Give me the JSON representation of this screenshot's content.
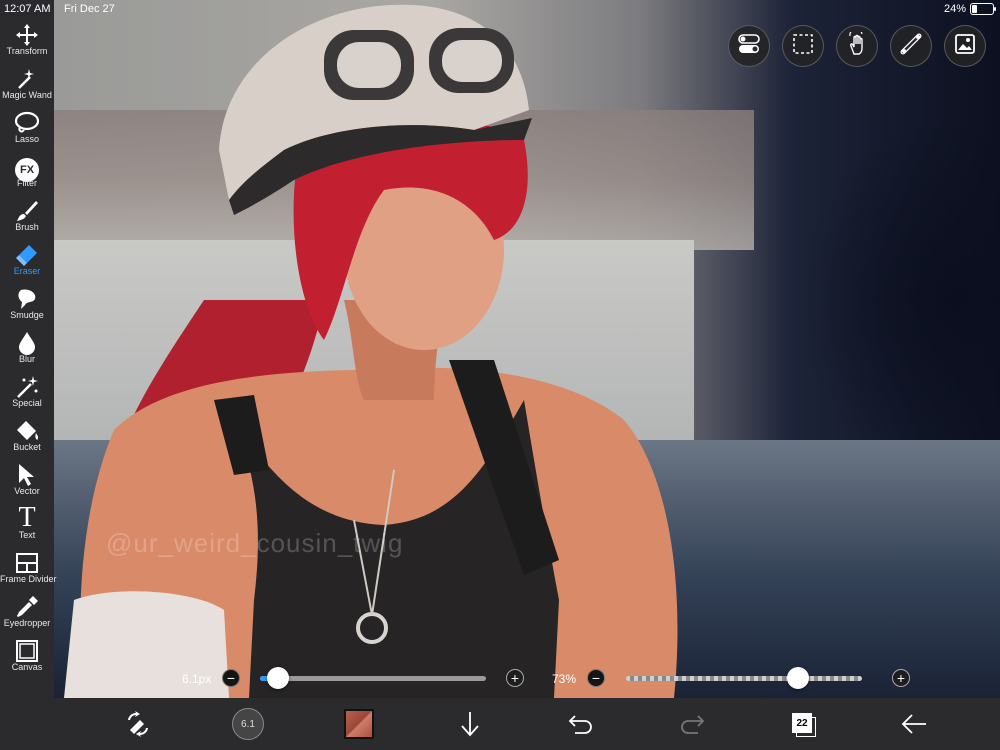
{
  "status_bar": {
    "time": "12:07 AM",
    "date": "Fri Dec 27",
    "battery_percent": "24%",
    "battery_level": 0.24
  },
  "toolbar": {
    "tools": [
      {
        "label": "Transform",
        "icon": "move-arrows-icon"
      },
      {
        "label": "Magic Wand",
        "icon": "magic-wand-icon"
      },
      {
        "label": "Lasso",
        "icon": "lasso-icon"
      },
      {
        "label": "Filter",
        "icon": "fx-icon",
        "glyph": "FX"
      },
      {
        "label": "Brush",
        "icon": "brush-icon"
      },
      {
        "label": "Eraser",
        "icon": "eraser-icon",
        "active": true
      },
      {
        "label": "Smudge",
        "icon": "smudge-icon"
      },
      {
        "label": "Blur",
        "icon": "droplet-icon"
      },
      {
        "label": "Special",
        "icon": "special-sparkle-icon"
      },
      {
        "label": "Bucket",
        "icon": "bucket-icon"
      },
      {
        "label": "Vector",
        "icon": "cursor-arrow-icon"
      },
      {
        "label": "Text",
        "icon": "text-icon",
        "glyph": "T"
      },
      {
        "label": "Frame Divider",
        "icon": "frame-divider-icon"
      },
      {
        "label": "Eyedropper",
        "icon": "eyedropper-icon"
      },
      {
        "label": "Canvas",
        "icon": "canvas-icon"
      }
    ],
    "active_color": "#2f9bff"
  },
  "top_buttons": [
    {
      "icon": "toggle-settings-icon"
    },
    {
      "icon": "selection-icon"
    },
    {
      "icon": "hand-gesture-icon"
    },
    {
      "icon": "ruler-icon"
    },
    {
      "icon": "gallery-icon"
    }
  ],
  "sliders": {
    "size": {
      "value_text": "6.1px",
      "level": 0.08
    },
    "opacity": {
      "value_text": "73%",
      "level": 0.73
    }
  },
  "canvas": {
    "watermark_text": "@ur_weird_cousin_twig"
  },
  "bottom_bar": {
    "brush_size_label": "6.1",
    "current_color": "#a9503f",
    "layer_count": "22"
  }
}
